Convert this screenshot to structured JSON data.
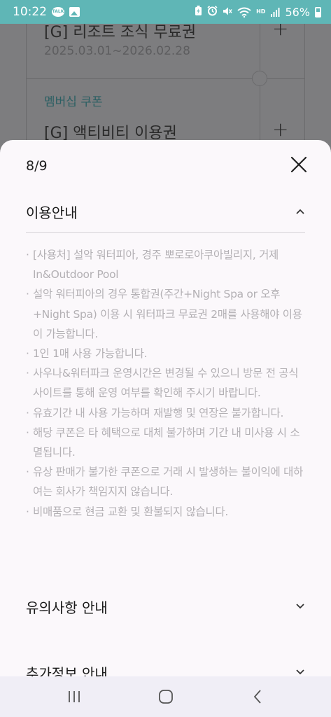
{
  "status_bar": {
    "time": "10:22",
    "battery": "56%",
    "icons": [
      "talk-icon",
      "gallery-icon",
      "battery-saver-icon",
      "alarm-icon",
      "mute-icon",
      "wifi-icon",
      "hd-icon",
      "signal-icon",
      "battery-icon"
    ],
    "hd_label": "HD",
    "talk_label": "TALK"
  },
  "background_page": {
    "coupon_top": {
      "title": "[G] 리조트 조식 무료권",
      "date": "2025.03.01~2026.02.28"
    },
    "section_label": "멤버십 쿠폰",
    "coupon_bottom": {
      "title": "[G] 액티비티 이용권"
    },
    "plus_symbol": "+"
  },
  "sheet": {
    "counter": "8/9",
    "sections": [
      {
        "title": "이용안내",
        "expanded": true,
        "notes": [
          "[사용처] 설악 워터피아, 경주 뽀로로아쿠아빌리지, 거제 In&Outdoor Pool",
          "설악 워터피아의 경우 통합권(주간+Night Spa or 오후+Night Spa) 이용 시 워터파크 무료권 2매를 사용해야 이용이 가능합니다.",
          "1인 1매 사용 가능합니다.",
          "사우나&워터파크 운영시간은 변경될 수 있으니 방문 전 공식 사이트를 통해 운영 여부를 확인해 주시기 바랍니다.",
          "유효기간 내 사용 가능하며 재발행 및 연장은 불가합니다.",
          "해당 쿠폰은 타 혜택으로 대체 불가하며 기간 내 미사용 시 소멸됩니다.",
          "유상 판매가 불가한 쿠폰으로 거래 시 발생하는 불이익에 대하여는 회사가 책임지지 않습니다.",
          "비매품으로 현금 교환 및 환불되지 않습니다."
        ]
      },
      {
        "title": "유의사항 안내",
        "expanded": false
      },
      {
        "title": "추가정보 안내",
        "expanded": false
      }
    ]
  },
  "nav_bar": {
    "buttons": [
      "recent-apps",
      "home",
      "back"
    ]
  }
}
